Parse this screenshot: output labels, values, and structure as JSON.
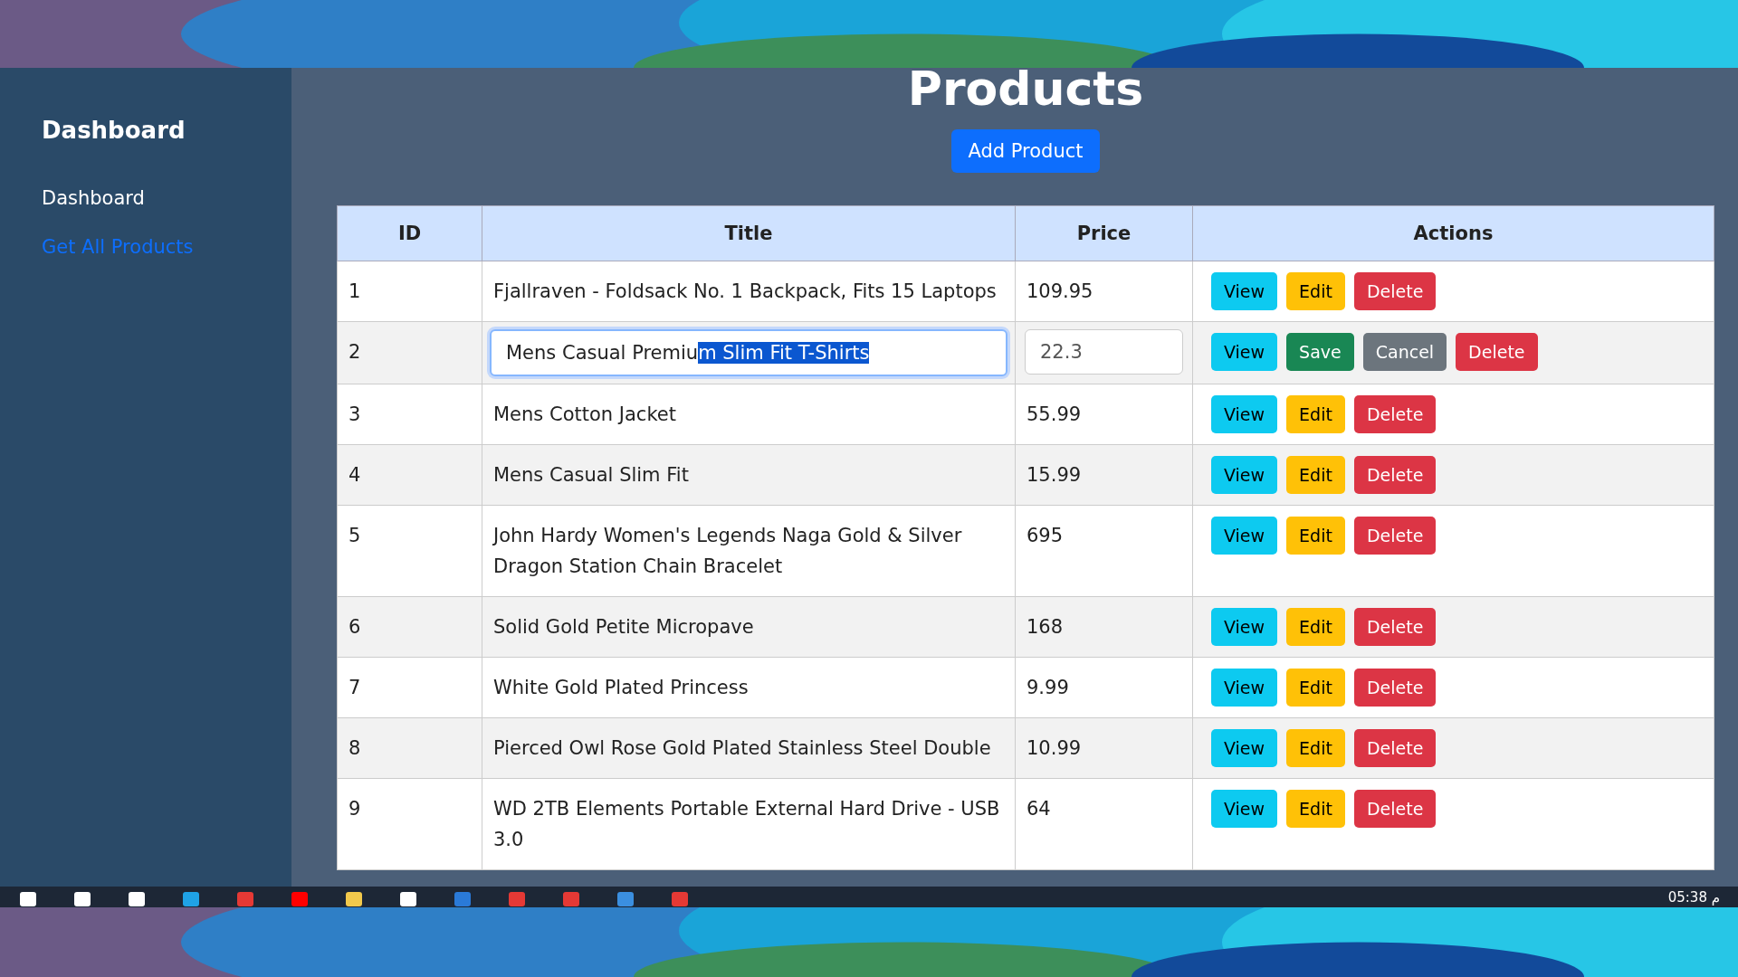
{
  "sidebar": {
    "title": "Dashboard",
    "items": [
      {
        "label": "Dashboard",
        "kind": "text"
      },
      {
        "label": "Get All Products",
        "kind": "link"
      }
    ]
  },
  "page": {
    "title": "Products",
    "add_button": "Add Product"
  },
  "table": {
    "columns": [
      "ID",
      "Title",
      "Price",
      "Actions"
    ],
    "rows": [
      {
        "id": "1",
        "title": "Fjallraven - Foldsack No. 1 Backpack, Fits 15 Laptops",
        "price": "109.95",
        "editing": false,
        "actions": [
          {
            "label": "View",
            "kind": "view"
          },
          {
            "label": "Edit",
            "kind": "edit"
          },
          {
            "label": "Delete",
            "kind": "delete"
          }
        ]
      },
      {
        "id": "2",
        "title_unselected": "Mens Casual Premiu",
        "title_selected": "m Slim Fit T-Shirts",
        "price": "22.3",
        "editing": true,
        "actions": [
          {
            "label": "View",
            "kind": "view"
          },
          {
            "label": "Save",
            "kind": "save"
          },
          {
            "label": "Cancel",
            "kind": "cancel"
          },
          {
            "label": "Delete",
            "kind": "delete"
          }
        ]
      },
      {
        "id": "3",
        "title": "Mens Cotton Jacket",
        "price": "55.99",
        "editing": false,
        "actions": [
          {
            "label": "View",
            "kind": "view"
          },
          {
            "label": "Edit",
            "kind": "edit"
          },
          {
            "label": "Delete",
            "kind": "delete"
          }
        ]
      },
      {
        "id": "4",
        "title": "Mens Casual Slim Fit",
        "price": "15.99",
        "editing": false,
        "actions": [
          {
            "label": "View",
            "kind": "view"
          },
          {
            "label": "Edit",
            "kind": "edit"
          },
          {
            "label": "Delete",
            "kind": "delete"
          }
        ]
      },
      {
        "id": "5",
        "title": "John Hardy Women's Legends Naga Gold & Silver Dragon Station Chain Bracelet",
        "price": "695",
        "editing": false,
        "actions": [
          {
            "label": "View",
            "kind": "view"
          },
          {
            "label": "Edit",
            "kind": "edit"
          },
          {
            "label": "Delete",
            "kind": "delete"
          }
        ]
      },
      {
        "id": "6",
        "title": "Solid Gold Petite Micropave",
        "price": "168",
        "editing": false,
        "actions": [
          {
            "label": "View",
            "kind": "view"
          },
          {
            "label": "Edit",
            "kind": "edit"
          },
          {
            "label": "Delete",
            "kind": "delete"
          }
        ]
      },
      {
        "id": "7",
        "title": "White Gold Plated Princess",
        "price": "9.99",
        "editing": false,
        "actions": [
          {
            "label": "View",
            "kind": "view"
          },
          {
            "label": "Edit",
            "kind": "edit"
          },
          {
            "label": "Delete",
            "kind": "delete"
          }
        ]
      },
      {
        "id": "8",
        "title": "Pierced Owl Rose Gold Plated Stainless Steel Double",
        "price": "10.99",
        "editing": false,
        "actions": [
          {
            "label": "View",
            "kind": "view"
          },
          {
            "label": "Edit",
            "kind": "edit"
          },
          {
            "label": "Delete",
            "kind": "delete"
          }
        ]
      },
      {
        "id": "9",
        "title": "WD 2TB Elements Portable External Hard Drive - USB 3.0",
        "price": "64",
        "editing": false,
        "actions": [
          {
            "label": "View",
            "kind": "view"
          },
          {
            "label": "Edit",
            "kind": "edit"
          },
          {
            "label": "Delete",
            "kind": "delete"
          }
        ]
      }
    ]
  },
  "taskbar": {
    "time": "05:38 م"
  }
}
